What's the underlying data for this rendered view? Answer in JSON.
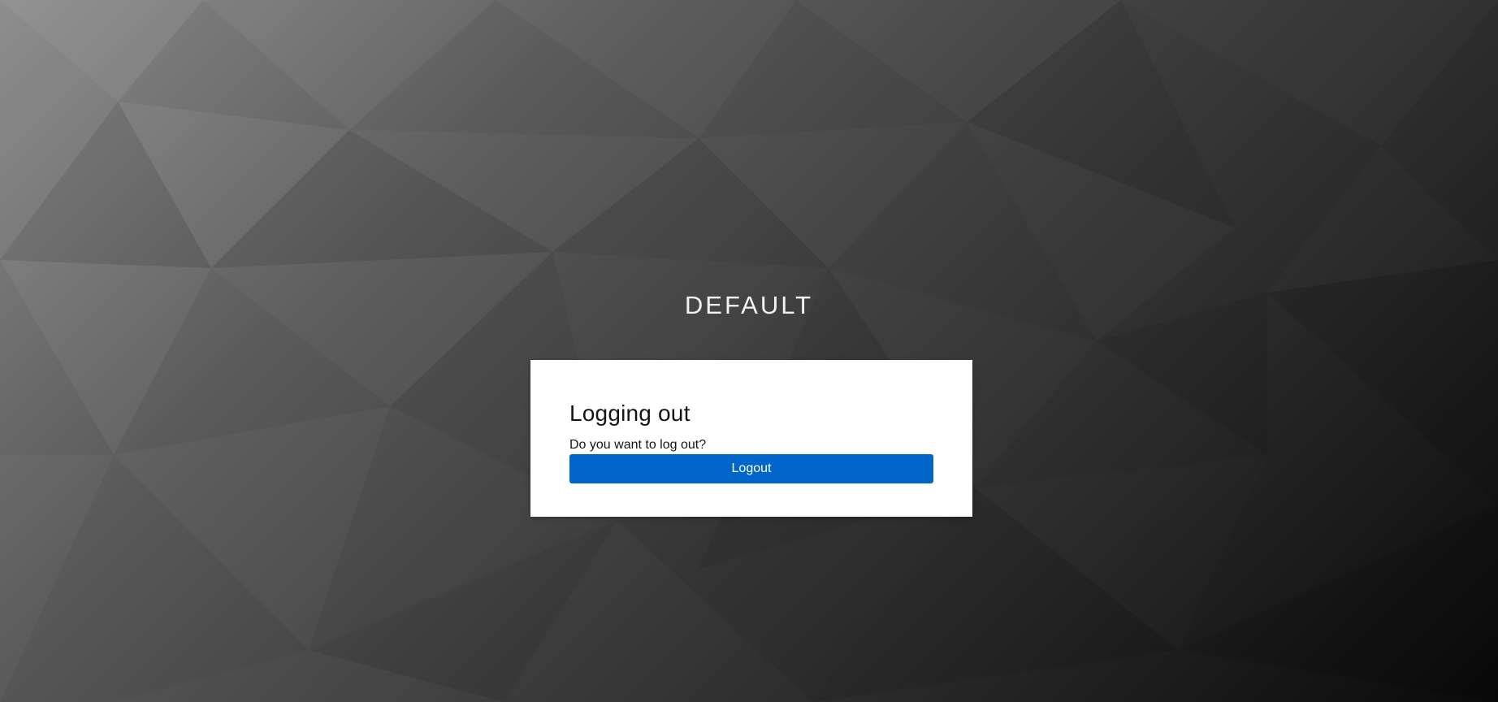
{
  "realm": {
    "name": "DEFAULT"
  },
  "card": {
    "title": "Logging out",
    "message": "Do you want to log out?",
    "logout_label": "Logout"
  },
  "colors": {
    "primary_button": "#0066cc",
    "card_background": "#ffffff"
  }
}
